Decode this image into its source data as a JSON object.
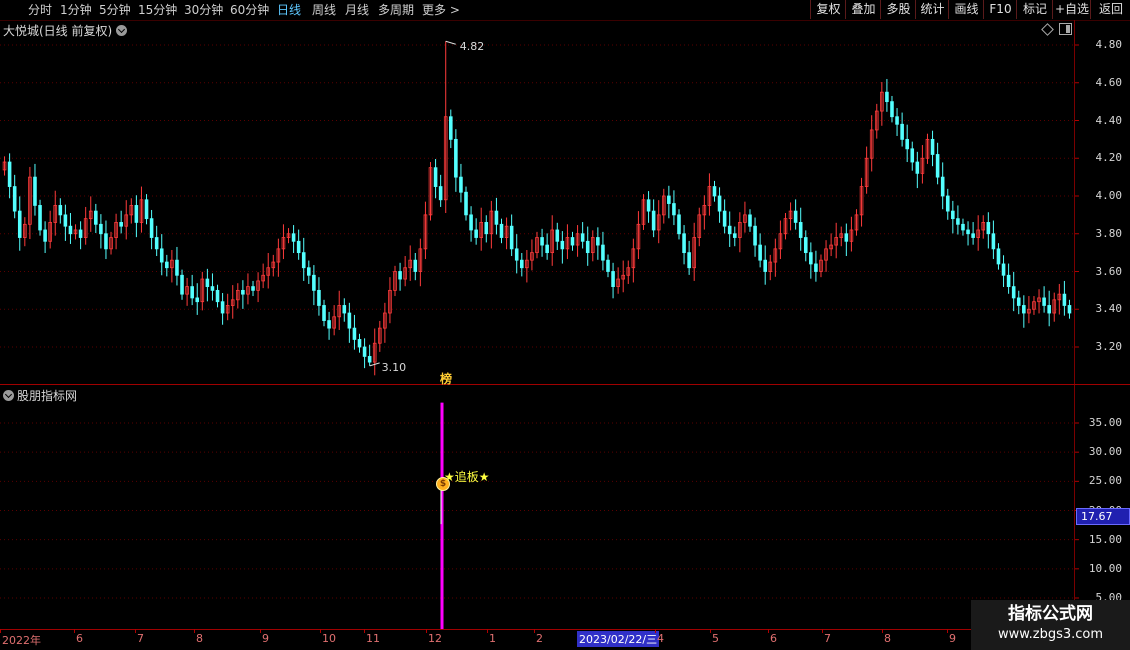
{
  "toolbar": {
    "periods": [
      "分时",
      "1分钟",
      "5分钟",
      "15分钟",
      "30分钟",
      "60分钟",
      "日线",
      "周线",
      "月线",
      "多周期",
      "更多"
    ],
    "active_period": "日线",
    "right_buttons": [
      "复权",
      "叠加",
      "多股",
      "统计",
      "画线",
      "F10",
      "标记",
      "+自选",
      "返回"
    ]
  },
  "main_panel": {
    "title": "大悦城(日线 前复权)",
    "high_label": "4.82",
    "low_label": "3.10",
    "badge": "榜",
    "y_ticks": [
      "4.80",
      "4.60",
      "4.40",
      "4.20",
      "4.00",
      "3.80",
      "3.60",
      "3.40",
      "3.20"
    ]
  },
  "indicator_panel": {
    "title": "股朋指标网",
    "signal_text": "★追板★",
    "current_value": "17.67",
    "y_ticks": [
      "35.00",
      "30.00",
      "25.00",
      "20.00",
      "15.00",
      "10.00",
      "5.00"
    ]
  },
  "x_axis": {
    "labels": [
      "2022年",
      "6",
      "7",
      "8",
      "9",
      "10",
      "11",
      "12",
      "1",
      "2",
      "2023/02/22/三",
      "4",
      "5",
      "6",
      "7",
      "8",
      "9"
    ]
  },
  "watermark": {
    "line1": "指标公式网",
    "line2": "www.zbgs3.com"
  },
  "colors": {
    "up": "#ff3b3b",
    "down": "#54ffff",
    "signal_bar": "#ff00ff",
    "axis": "#b00000",
    "highlight": "#3030c8"
  },
  "chart_data": {
    "type": "candlestick",
    "ylim": [
      3.05,
      4.9
    ],
    "high": 4.82,
    "low": 3.1,
    "closes": [
      4.18,
      4.05,
      3.92,
      3.78,
      3.85,
      4.1,
      3.95,
      3.82,
      3.76,
      3.86,
      3.95,
      3.9,
      3.84,
      3.8,
      3.82,
      3.78,
      3.88,
      3.92,
      3.85,
      3.8,
      3.72,
      3.78,
      3.86,
      3.84,
      3.9,
      3.95,
      3.86,
      3.98,
      3.88,
      3.78,
      3.72,
      3.65,
      3.62,
      3.66,
      3.58,
      3.48,
      3.52,
      3.46,
      3.44,
      3.56,
      3.52,
      3.5,
      3.44,
      3.38,
      3.42,
      3.45,
      3.5,
      3.48,
      3.52,
      3.5,
      3.55,
      3.58,
      3.62,
      3.65,
      3.72,
      3.78,
      3.8,
      3.76,
      3.7,
      3.62,
      3.58,
      3.5,
      3.42,
      3.34,
      3.3,
      3.36,
      3.42,
      3.38,
      3.3,
      3.24,
      3.2,
      3.15,
      3.12,
      3.22,
      3.3,
      3.38,
      3.5,
      3.6,
      3.56,
      3.62,
      3.66,
      3.6,
      3.72,
      3.9,
      4.15,
      4.05,
      3.98,
      4.42,
      4.3,
      4.1,
      4.02,
      3.9,
      3.82,
      3.78,
      3.86,
      3.8,
      3.92,
      3.85,
      3.78,
      3.84,
      3.72,
      3.66,
      3.62,
      3.66,
      3.7,
      3.78,
      3.74,
      3.7,
      3.82,
      3.76,
      3.72,
      3.78,
      3.74,
      3.8,
      3.76,
      3.7,
      3.78,
      3.74,
      3.66,
      3.6,
      3.52,
      3.56,
      3.58,
      3.62,
      3.72,
      3.85,
      3.98,
      3.92,
      3.82,
      3.9,
      4.0,
      3.96,
      3.9,
      3.8,
      3.7,
      3.62,
      3.78,
      3.9,
      3.95,
      4.05,
      4.0,
      3.92,
      3.84,
      3.8,
      3.78,
      3.86,
      3.9,
      3.84,
      3.74,
      3.66,
      3.6,
      3.65,
      3.72,
      3.8,
      3.88,
      3.92,
      3.86,
      3.78,
      3.7,
      3.64,
      3.6,
      3.66,
      3.72,
      3.74,
      3.78,
      3.8,
      3.76,
      3.82,
      3.9,
      4.05,
      4.2,
      4.35,
      4.45,
      4.55,
      4.5,
      4.42,
      4.38,
      4.3,
      4.25,
      4.18,
      4.12,
      4.2,
      4.3,
      4.22,
      4.1,
      4.0,
      3.92,
      3.88,
      3.85,
      3.82,
      3.8,
      3.78,
      3.82,
      3.86,
      3.8,
      3.72,
      3.64,
      3.58,
      3.52,
      3.46,
      3.42,
      3.38,
      3.4,
      3.44,
      3.46,
      3.42,
      3.38,
      3.45,
      3.48,
      3.42,
      3.38
    ]
  },
  "indicator_data": {
    "type": "bar",
    "ylim": [
      4,
      40
    ],
    "signal_value": 25,
    "signal_bar_top": 38.5,
    "current_value": 17.67
  }
}
